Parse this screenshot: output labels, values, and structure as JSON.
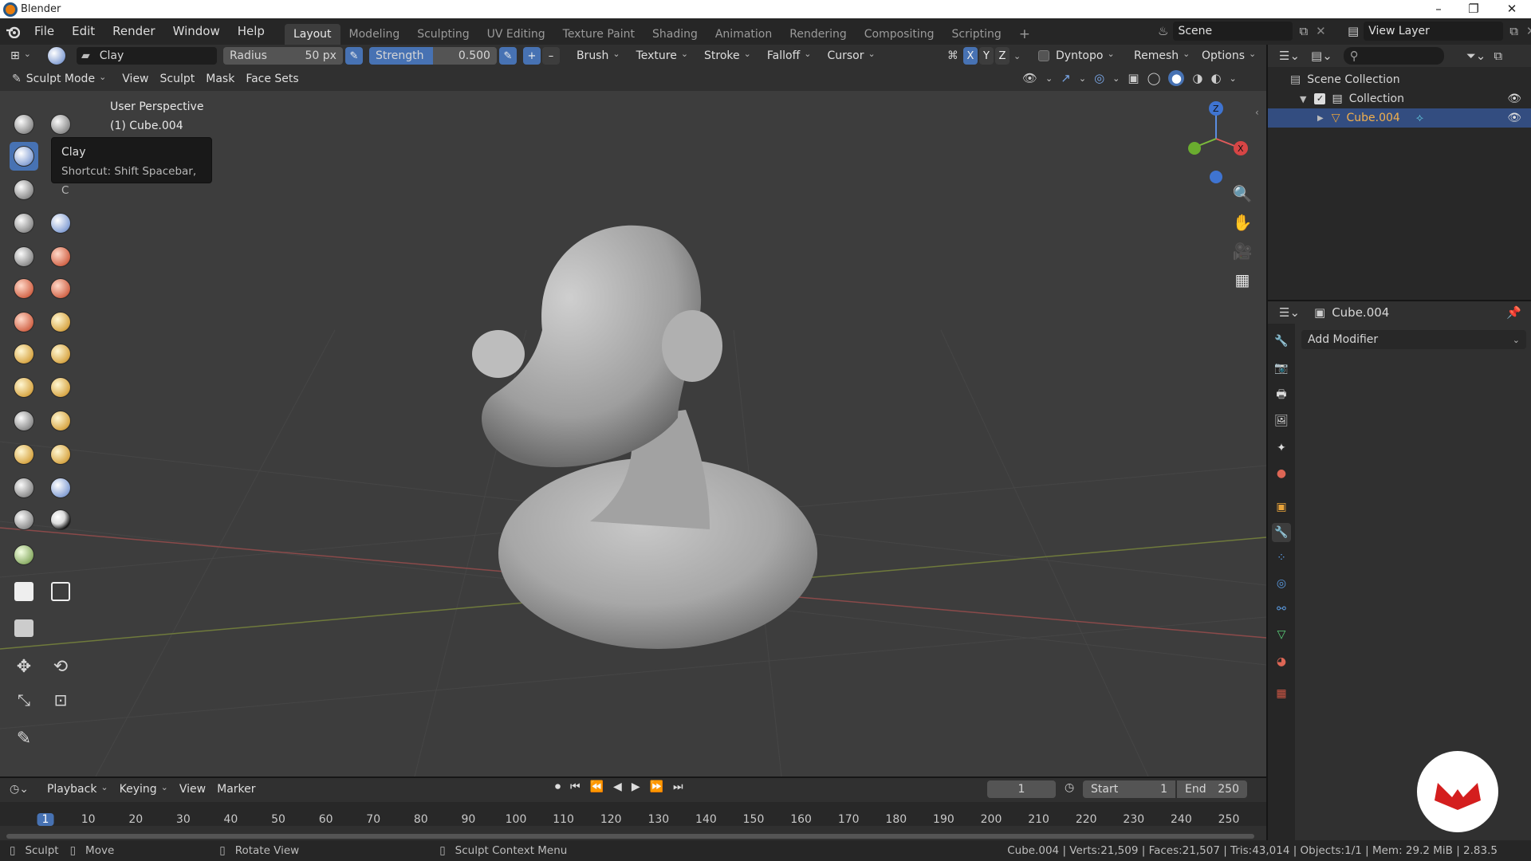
{
  "window": {
    "title": "Blender",
    "minimize": "–",
    "maximize": "❐",
    "close": "✕"
  },
  "menu": [
    "File",
    "Edit",
    "Render",
    "Window",
    "Help"
  ],
  "workspaces": [
    "Layout",
    "Modeling",
    "Sculpting",
    "UV Editing",
    "Texture Paint",
    "Shading",
    "Animation",
    "Rendering",
    "Compositing",
    "Scripting"
  ],
  "workspace_add": "+",
  "scene": {
    "label": "Scene"
  },
  "view_layer": {
    "label": "View Layer"
  },
  "tool_header": {
    "brush_name": "Clay",
    "radius_label": "Radius",
    "radius_value": "50 px",
    "strength_label": "Strength",
    "strength_value": "0.500",
    "plus": "+",
    "minus": "–",
    "dropdowns": [
      "Brush",
      "Texture",
      "Stroke",
      "Falloff",
      "Cursor"
    ],
    "symmetry": [
      "X",
      "Y",
      "Z"
    ],
    "dyntopo": "Dyntopo",
    "remesh": "Remesh",
    "options": "Options"
  },
  "mode_header": {
    "mode": "Sculpt Mode",
    "items": [
      "View",
      "Sculpt",
      "Mask",
      "Face Sets"
    ]
  },
  "viewport": {
    "perspective": "User Perspective",
    "object": "(1) Cube.004"
  },
  "tooltip": {
    "title": "Clay",
    "shortcut": "Shortcut: Shift Spacebar, C"
  },
  "gizmo": {
    "x": "X",
    "y": "Y",
    "z": "Z"
  },
  "outliner": {
    "scene_collection": "Scene Collection",
    "collection": "Collection",
    "object": "Cube.004"
  },
  "properties": {
    "object": "Cube.004",
    "add_modifier": "Add Modifier"
  },
  "timeline": {
    "menus": [
      "Playback",
      "Keying",
      "View",
      "Marker"
    ],
    "current_frame": "1",
    "start_label": "Start",
    "start_value": "1",
    "end_label": "End",
    "end_value": "250",
    "ticks": [
      "1",
      "10",
      "20",
      "30",
      "40",
      "50",
      "60",
      "70",
      "80",
      "90",
      "100",
      "110",
      "120",
      "130",
      "140",
      "150",
      "160",
      "170",
      "180",
      "190",
      "200",
      "210",
      "220",
      "230",
      "240",
      "250"
    ]
  },
  "status": {
    "sculpt": "Sculpt",
    "move": "Move",
    "rotate": "Rotate View",
    "context": "Sculpt Context Menu",
    "stats": "Cube.004 | Verts:21,509 | Faces:21,507 | Tris:43,014 | Objects:1/1 | Mem: 29.2 MiB | 2.83.5"
  },
  "colors": {
    "accent": "#4772b3",
    "selected_row": "#334d80",
    "object_orange": "#e8a33a"
  }
}
